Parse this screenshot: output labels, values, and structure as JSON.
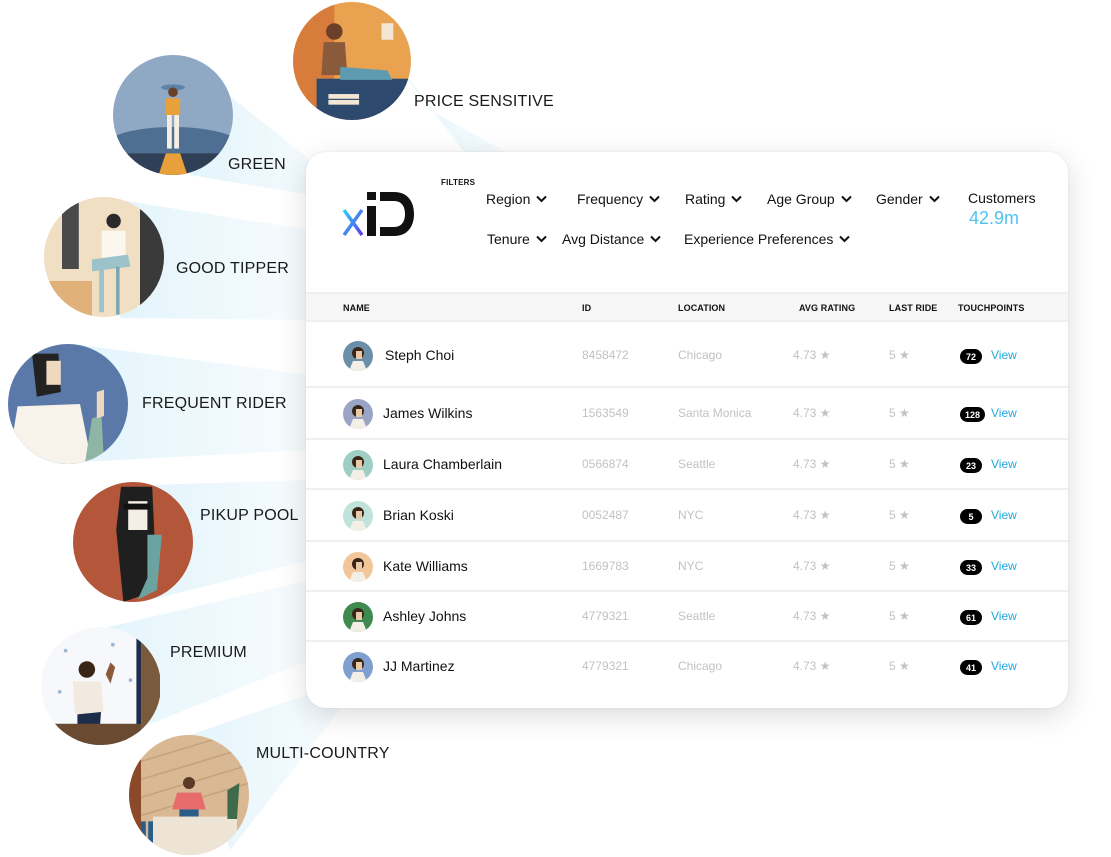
{
  "personas": [
    {
      "label": "PRICE SENSITIVE",
      "icon": "price-sensitive-illustration",
      "colors": [
        "#e9a24f",
        "#c8552a",
        "#2d4a6e",
        "#f3e7d3"
      ]
    },
    {
      "label": "GREEN",
      "icon": "green-illustration",
      "colors": [
        "#8fa9c5",
        "#3d5a7a",
        "#e8a03a",
        "#f5efe3"
      ]
    },
    {
      "label": "GOOD TIPPER",
      "icon": "good-tipper-illustration",
      "colors": [
        "#f1dfc3",
        "#4a4a4a",
        "#9cc3c9",
        "#fbf6ee"
      ]
    },
    {
      "label": "FREQUENT RIDER",
      "icon": "frequent-rider-illustration",
      "colors": [
        "#5b79a8",
        "#f7f2ea",
        "#222222",
        "#efd8c0"
      ]
    },
    {
      "label": "PIKUP POOL",
      "icon": "pikup-pool-illustration",
      "colors": [
        "#b4563a",
        "#1f1f1f",
        "#f4efe6",
        "#6aa3a0"
      ]
    },
    {
      "label": "PREMIUM",
      "icon": "premium-illustration",
      "colors": [
        "#f6f8fb",
        "#7a5a3c",
        "#1e2d4a",
        "#f2eadf"
      ]
    },
    {
      "label": "MULTI-COUNTRY",
      "icon": "multi-country-illustration",
      "colors": [
        "#d9b894",
        "#e76b6b",
        "#2b5d8a",
        "#eee4d5"
      ]
    }
  ],
  "dashboard": {
    "logo": {
      "x_letter": "x",
      "id_letters": "ID"
    },
    "filters_title": "FILTERS",
    "filters": [
      {
        "label": "Region"
      },
      {
        "label": "Frequency"
      },
      {
        "label": "Rating"
      },
      {
        "label": "Age Group"
      },
      {
        "label": "Gender"
      },
      {
        "label": "Tenure"
      },
      {
        "label": "Avg Distance"
      },
      {
        "label": "Experience Preferences"
      }
    ],
    "customers": {
      "label": "Customers",
      "value": "42.9m",
      "accent": "#4ec3f0"
    },
    "table": {
      "columns": [
        "NAME",
        "ID",
        "LOCATION",
        "AVG RATING",
        "LAST RIDE",
        "TOUCHPOINTS"
      ],
      "view_label": "View",
      "star_glyph": "★",
      "rows": [
        {
          "name": "Steph Choi",
          "id": "8458472",
          "location": "Chicago",
          "avg_rating": "4.73",
          "last_ride": "5",
          "touchpoints": "72",
          "avatar_bg": "#6b8fa8"
        },
        {
          "name": "James Wilkins",
          "id": "1563549",
          "location": "Santa Monica",
          "avg_rating": "4.73",
          "last_ride": "5",
          "touchpoints": "128",
          "avatar_bg": "#9aa4c4"
        },
        {
          "name": "Laura Chamberlain",
          "id": "0566874",
          "location": "Seattle",
          "avg_rating": "4.73",
          "last_ride": "5",
          "touchpoints": "23",
          "avatar_bg": "#9fcfc4"
        },
        {
          "name": "Brian Koski",
          "id": "0052487",
          "location": "NYC",
          "avg_rating": "4.73",
          "last_ride": "5",
          "touchpoints": "5",
          "avatar_bg": "#bfe2da"
        },
        {
          "name": "Kate Williams",
          "id": "1669783",
          "location": "NYC",
          "avg_rating": "4.73",
          "last_ride": "5",
          "touchpoints": "33",
          "avatar_bg": "#f1c79a"
        },
        {
          "name": "Ashley Johns",
          "id": "4779321",
          "location": "Seattle",
          "avg_rating": "4.73",
          "last_ride": "5",
          "touchpoints": "61",
          "avatar_bg": "#3f8a4f"
        },
        {
          "name": "JJ Martinez",
          "id": "4779321",
          "location": "Chicago",
          "avg_rating": "4.73",
          "last_ride": "5",
          "touchpoints": "41",
          "avatar_bg": "#7f9fd1"
        }
      ]
    }
  }
}
